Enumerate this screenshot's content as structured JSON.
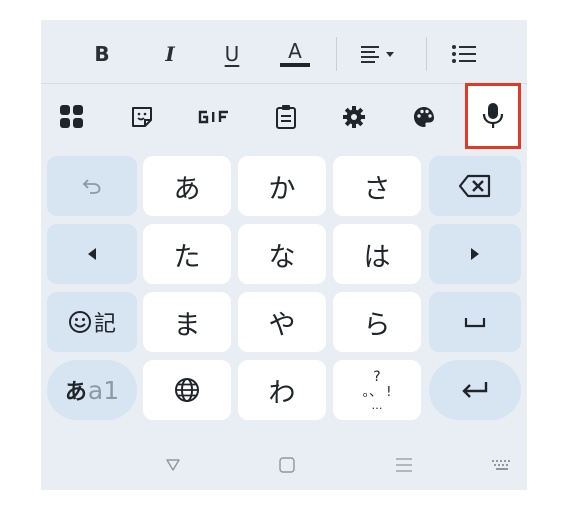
{
  "format_bar": {
    "bold": "B",
    "italic": "I",
    "underline": "U",
    "font_color": "A"
  },
  "keys": {
    "row1": [
      "あ",
      "か",
      "さ"
    ],
    "row2": [
      "た",
      "な",
      "は"
    ],
    "row3": [
      "ま",
      "や",
      "ら"
    ],
    "row4_wa": "わ",
    "emoji_kanji": "記",
    "mode_a": "あ",
    "mode_b": "a1",
    "punct_top": "?",
    "punct_mid": "。、 !",
    "punct_bottom": "…"
  },
  "icons": {
    "bold": "bold-icon",
    "italic": "italic-icon",
    "underline": "underline-icon",
    "font_color": "font-color-icon",
    "align": "align-icon",
    "list": "list-icon",
    "apps": "apps-grid-icon",
    "sticker": "sticker-icon",
    "gif": "gif-icon",
    "clipboard": "clipboard-icon",
    "settings": "gear-icon",
    "theme": "palette-icon",
    "mic": "microphone-icon",
    "undo": "undo-icon",
    "backspace": "backspace-icon",
    "left": "arrow-left-icon",
    "right": "arrow-right-icon",
    "space": "space-icon",
    "globe": "globe-icon",
    "enter": "enter-icon",
    "nav_back": "nav-back-icon",
    "nav_home": "nav-home-icon",
    "nav_recent": "nav-recents-icon",
    "nav_keyboard": "keyboard-icon"
  },
  "colors": {
    "keyboard_bg": "#e9eef4",
    "key_white": "#ffffff",
    "key_blue": "#d7e4f1",
    "highlight": "#e13b27"
  }
}
